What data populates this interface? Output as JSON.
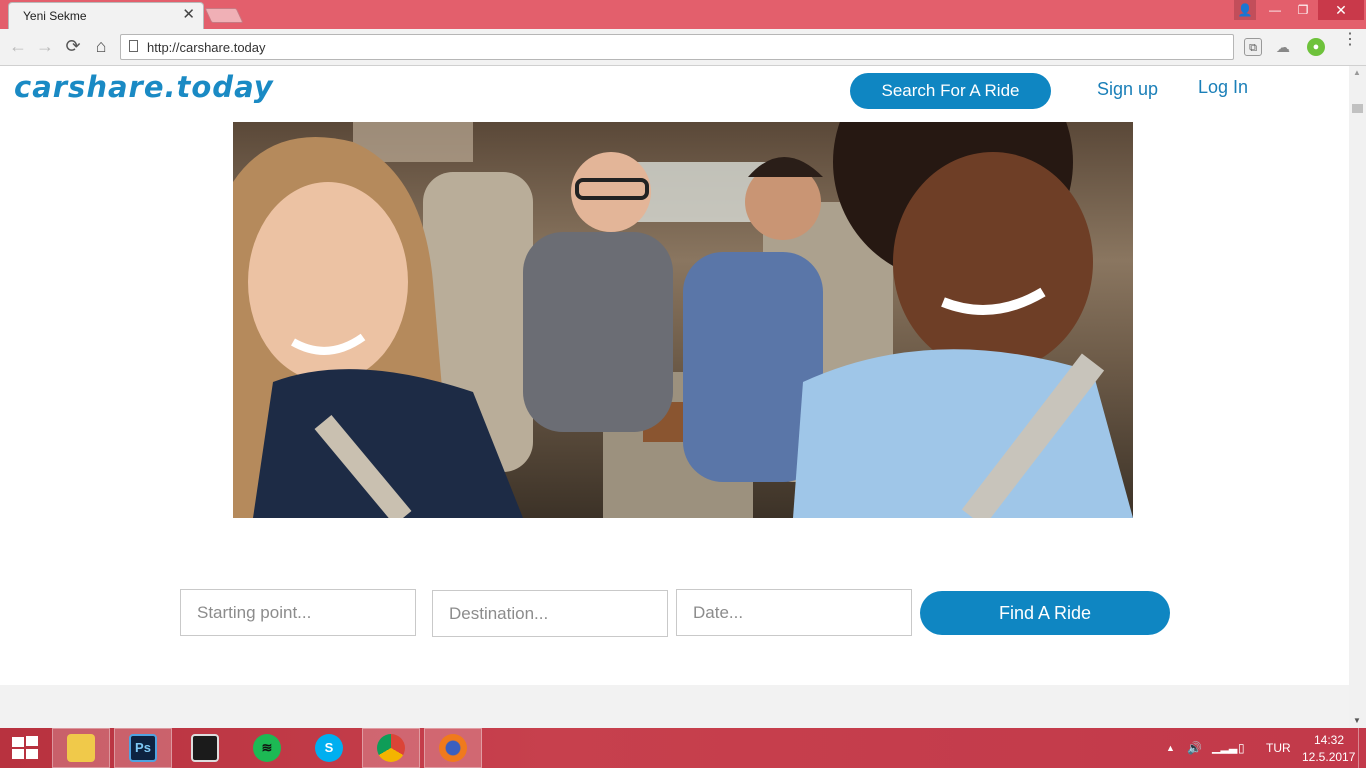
{
  "browser": {
    "tab_title": "Yeni Sekme",
    "tab_close": "✕",
    "url": "http://carshare.today",
    "window_controls": {
      "user": "👤",
      "minimize": "—",
      "maximize": "❐",
      "close": "✕"
    },
    "nav": {
      "back": "←",
      "forward": "→",
      "reload": "⟳",
      "home": "⌂",
      "menu": "⋮"
    }
  },
  "page": {
    "logo": "carshare.today",
    "nav": {
      "search_ride": "Search For A Ride",
      "sign_up": "Sign up",
      "log_in": "Log In"
    },
    "search_form": {
      "start_placeholder": "Starting point...",
      "destination_placeholder": "Destination...",
      "date_placeholder": "Date...",
      "find_button": "Find A Ride"
    },
    "accent_color": "#0f86c2"
  },
  "taskbar": {
    "apps": [
      {
        "name": "file-explorer-icon",
        "label": ""
      },
      {
        "name": "photoshop-icon",
        "label": "Ps"
      },
      {
        "name": "video-editor-icon",
        "label": ""
      },
      {
        "name": "spotify-icon",
        "label": ""
      },
      {
        "name": "skype-icon",
        "label": "S"
      },
      {
        "name": "chrome-icon",
        "label": ""
      },
      {
        "name": "firefox-icon",
        "label": ""
      }
    ],
    "language": "TUR",
    "time": "14:32",
    "date": "12.5.2017"
  }
}
